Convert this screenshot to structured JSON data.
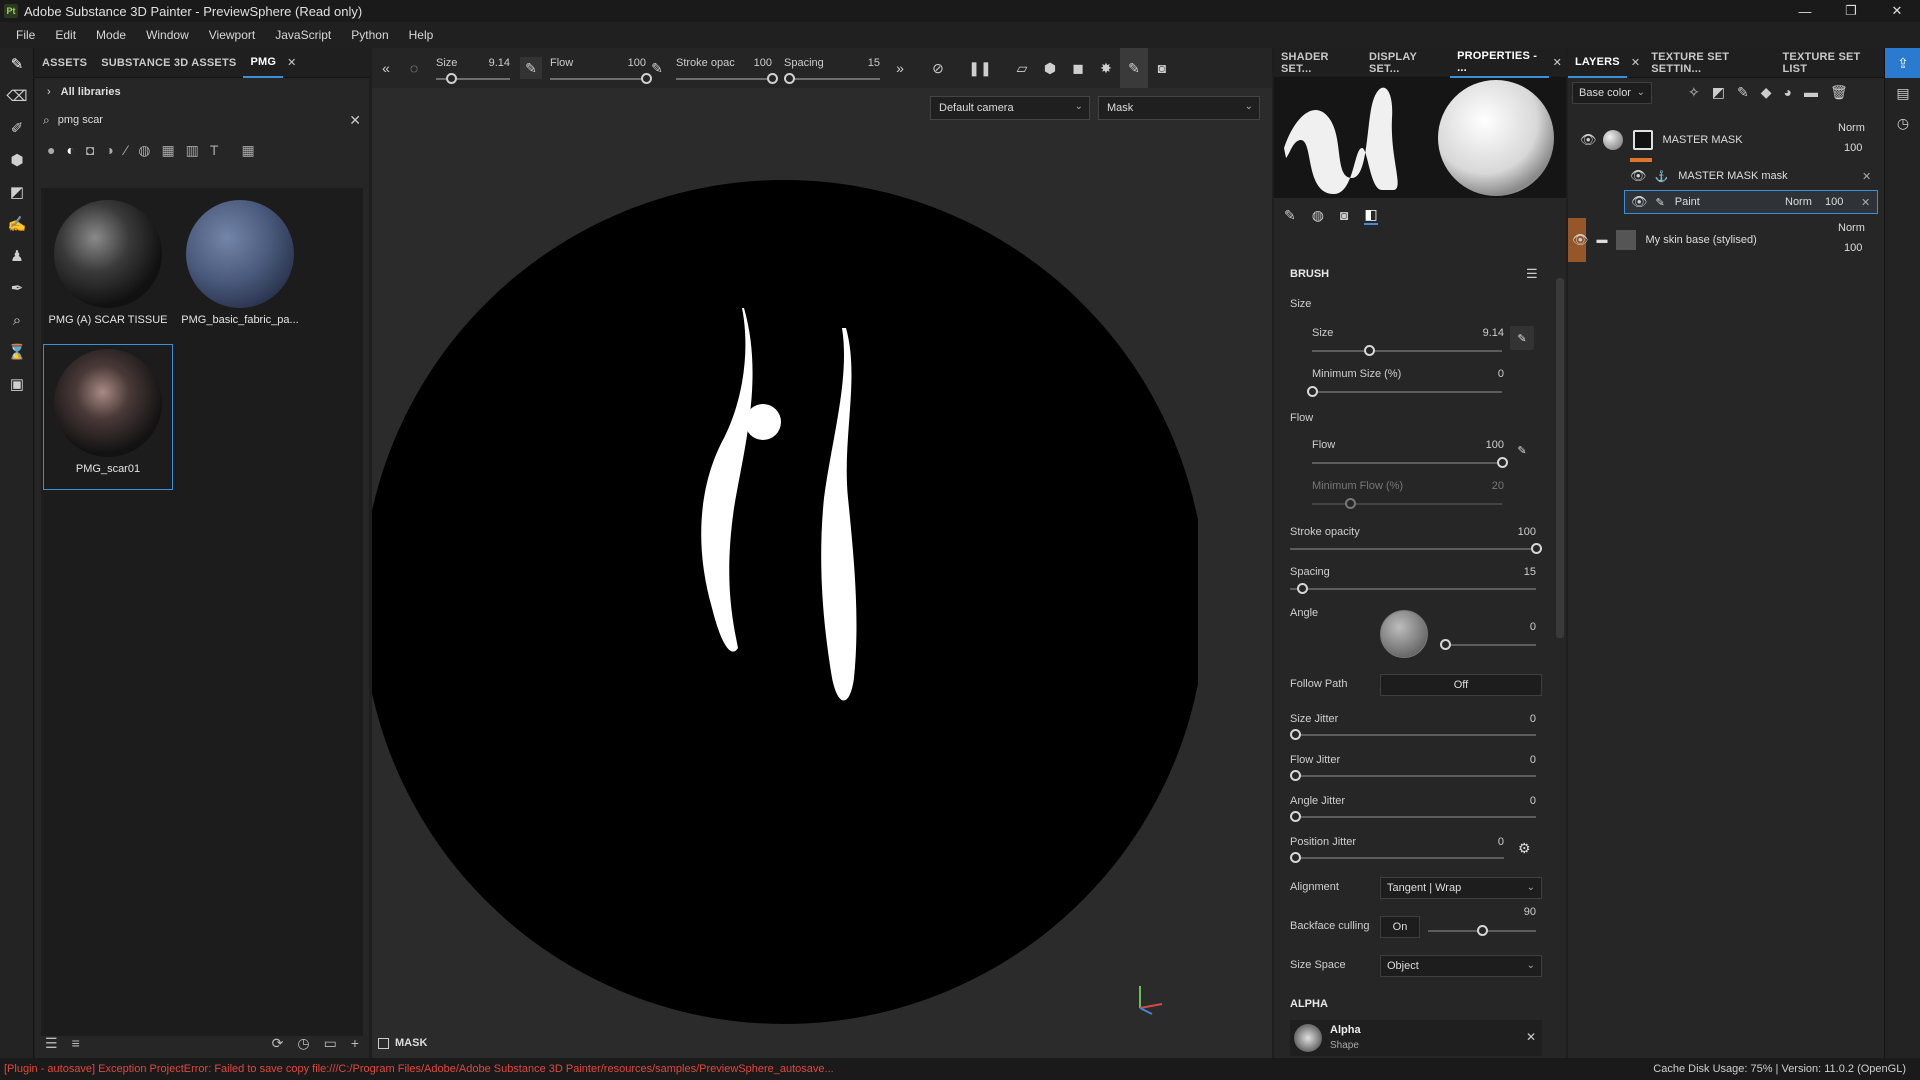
{
  "window": {
    "title": "Adobe Substance 3D Painter - PreviewSphere (Read only)",
    "logo": "Pt",
    "minimize": "—",
    "restore": "❐",
    "close": "✕"
  },
  "menu": [
    "File",
    "Edit",
    "Mode",
    "Window",
    "Viewport",
    "JavaScript",
    "Python",
    "Help"
  ],
  "assets": {
    "tabs": {
      "assets": "ASSETS",
      "s3d": "SUBSTANCE 3D ASSETS",
      "pmg": "PMG",
      "close": "✕"
    },
    "library": "All libraries",
    "search": {
      "value": "pmg scar",
      "placeholder": "Search"
    },
    "items": [
      {
        "label": "PMG (A) SCAR TISSUE"
      },
      {
        "label": "PMG_basic_fabric_pa..."
      },
      {
        "label": "PMG_scar01"
      }
    ]
  },
  "toolbar": {
    "size": {
      "label": "Size",
      "value": "9.14",
      "fraction": 0.2
    },
    "flow": {
      "label": "Flow",
      "value": "100",
      "fraction": 1.0
    },
    "stroke": {
      "label": "Stroke opac",
      "value": "100",
      "fraction": 1.0
    },
    "spacing": {
      "label": "Spacing",
      "value": "15",
      "fraction": 0.05
    },
    "camera": "Default camera",
    "mode": "Mask"
  },
  "viewport": {
    "footer": "MASK"
  },
  "props": {
    "tabs": {
      "shader": "SHADER SET...",
      "display": "DISPLAY SET...",
      "properties": "PROPERTIES - ...",
      "close": "✕"
    },
    "brush_title": "BRUSH",
    "size_group": "Size",
    "size": {
      "label": "Size",
      "value": "9.14",
      "fraction": 0.3
    },
    "min_size": {
      "label": "Minimum Size (%)",
      "value": "0",
      "fraction": 0
    },
    "flow_group": "Flow",
    "flow": {
      "label": "Flow",
      "value": "100",
      "fraction": 1.0
    },
    "min_flow": {
      "label": "Minimum Flow (%)",
      "value": "20",
      "fraction": 0.2
    },
    "stroke_opacity": {
      "label": "Stroke opacity",
      "value": "100",
      "fraction": 1.0
    },
    "spacing": {
      "label": "Spacing",
      "value": "15",
      "fraction": 0.05
    },
    "angle": {
      "label": "Angle",
      "value": "0"
    },
    "follow_path": {
      "label": "Follow Path",
      "value": "Off"
    },
    "size_jitter": {
      "label": "Size Jitter",
      "value": "0"
    },
    "flow_jitter": {
      "label": "Flow Jitter",
      "value": "0"
    },
    "angle_jitter": {
      "label": "Angle Jitter",
      "value": "0"
    },
    "position_jitter": {
      "label": "Position Jitter",
      "value": "0"
    },
    "alignment": {
      "label": "Alignment",
      "value": "Tangent | Wrap"
    },
    "backface": {
      "label": "Backface culling",
      "toggle": "On",
      "value": "90",
      "fraction": 0.5
    },
    "size_space": {
      "label": "Size Space",
      "value": "Object"
    },
    "alpha_title": "ALPHA",
    "alpha": {
      "name": "Alpha",
      "sub": "Shape"
    }
  },
  "layers": {
    "tabs": {
      "layers": "LAYERS",
      "close": "✕",
      "tss": "TEXTURE SET SETTIN...",
      "tsl": "TEXTURE SET LIST"
    },
    "channel": "Base color",
    "rows": [
      {
        "name": "MASTER MASK",
        "blend": "Norm",
        "opacity": "100"
      },
      {
        "name": "MASTER MASK mask"
      },
      {
        "name": "Paint",
        "blend": "Norm",
        "opacity": "100"
      },
      {
        "name": "My skin base (stylised)",
        "blend": "Norm",
        "opacity": "100"
      }
    ]
  },
  "status": {
    "error": "[Plugin - autosave] Exception ProjectError: Failed to save copy file:///C:/Program Files/Adobe/Adobe Substance 3D Painter/resources/samples/PreviewSphere_autosave...",
    "info": "Cache Disk Usage:    75% | Version: 11.0.2 (OpenGL)"
  },
  "colors": {
    "accent": "#3a8fd9",
    "error": "#e0483d",
    "layer_orange": "#e0762c"
  }
}
